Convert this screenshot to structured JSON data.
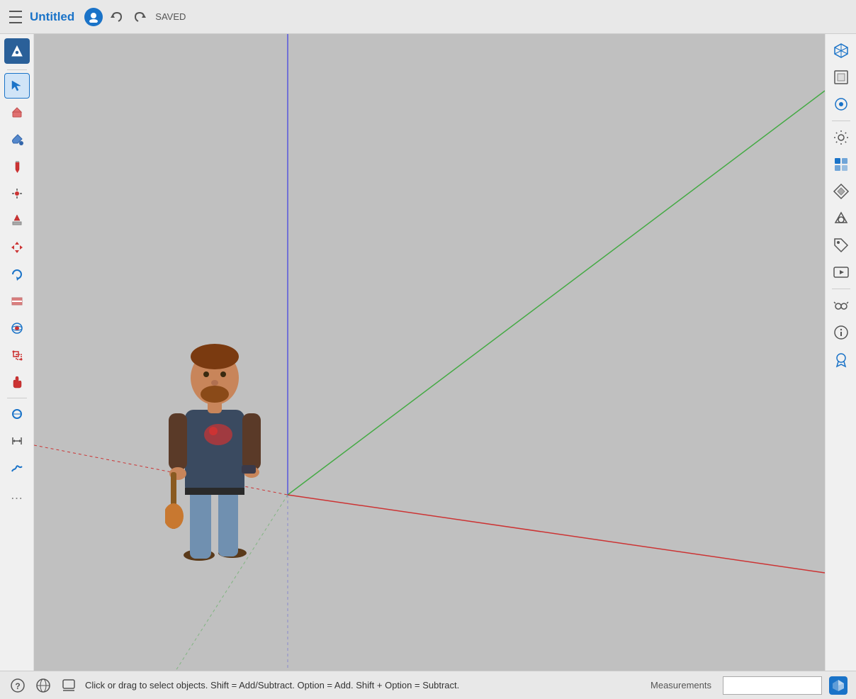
{
  "titlebar": {
    "title": "Untitled",
    "saved_label": "SAVED",
    "menu_icon": "menu-icon",
    "undo_icon": "↩",
    "redo_icon": "↪"
  },
  "left_toolbar": {
    "tools": [
      {
        "name": "plugin-tool",
        "label": "✈",
        "active": false,
        "plugin": true
      },
      {
        "name": "select-tool",
        "label": "↖",
        "active": true
      },
      {
        "name": "eraser-tool",
        "label": "◻",
        "active": false
      },
      {
        "name": "paint-tool",
        "label": "⊛",
        "active": false
      },
      {
        "name": "line-tool",
        "label": "✏",
        "active": false
      },
      {
        "name": "point-tool",
        "label": "•",
        "active": false
      },
      {
        "name": "push-pull-tool",
        "label": "⬆",
        "active": false
      },
      {
        "name": "move-tool",
        "label": "✛",
        "active": false
      },
      {
        "name": "rotate-tool",
        "label": "↻",
        "active": false
      },
      {
        "name": "section-tool",
        "label": "⊡",
        "active": false
      },
      {
        "name": "orbit-tool",
        "label": "◉",
        "active": false
      },
      {
        "name": "scale-tool",
        "label": "⊞",
        "active": false
      },
      {
        "name": "pan-tool",
        "label": "✋",
        "active": false
      },
      {
        "name": "tape-tool",
        "label": "📐",
        "active": false
      },
      {
        "name": "dimension-tool",
        "label": "⊤",
        "active": false
      },
      {
        "name": "freehand-tool",
        "label": "〜",
        "active": false
      },
      {
        "name": "more-tools",
        "label": "…",
        "active": false
      }
    ]
  },
  "right_toolbar": {
    "tools": [
      {
        "name": "iso-view",
        "label": "cube-iso"
      },
      {
        "name": "top-view",
        "label": "cube-top"
      },
      {
        "name": "front-view",
        "label": "cube-front"
      },
      {
        "name": "settings",
        "label": "gear"
      },
      {
        "name": "components",
        "label": "component"
      },
      {
        "name": "materials",
        "label": "material"
      },
      {
        "name": "shape",
        "label": "shape"
      },
      {
        "name": "tags",
        "label": "tags"
      },
      {
        "name": "scenes",
        "label": "film"
      },
      {
        "name": "inspector",
        "label": "glasses"
      },
      {
        "name": "info",
        "label": "info"
      },
      {
        "name": "extensions",
        "label": "medal"
      }
    ]
  },
  "viewport": {
    "background_color": "#c0c0c0"
  },
  "bottombar": {
    "status_text": "Click or drag to select objects. Shift = Add/Subtract. Option = Add. Shift + Option = Subtract.",
    "measurements_label": "Measurements",
    "measurements_value": ""
  },
  "colors": {
    "axis_blue": "#4444cc",
    "axis_green": "#44aa44",
    "axis_red": "#cc4444",
    "axis_dotted": "#cc4444"
  }
}
